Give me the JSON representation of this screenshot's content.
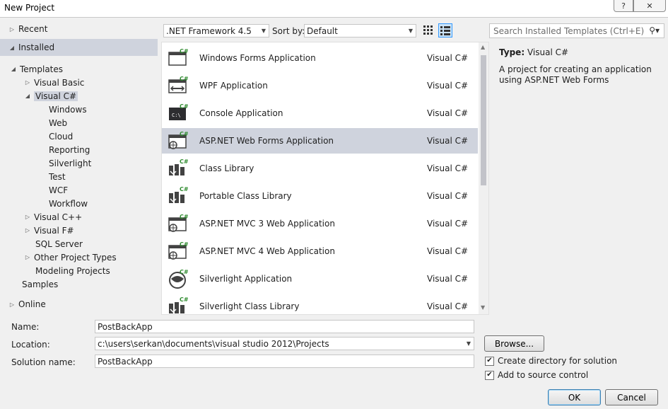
{
  "window": {
    "title": "New Project",
    "help_label": "?",
    "close_label": "✕"
  },
  "tree": {
    "recent": "Recent",
    "installed": "Installed",
    "templates": "Templates",
    "visual_basic": "Visual Basic",
    "visual_csharp": "Visual C#",
    "csharp_children": [
      "Windows",
      "Web",
      "Cloud",
      "Reporting",
      "Silverlight",
      "Test",
      "WCF",
      "Workflow"
    ],
    "visual_cpp": "Visual C++",
    "visual_fsharp": "Visual F#",
    "sql_server": "SQL Server",
    "other_project_types": "Other Project Types",
    "modeling_projects": "Modeling Projects",
    "samples": "Samples",
    "online": "Online"
  },
  "toolbar": {
    "framework": ".NET Framework 4.5",
    "sort_label": "Sort by:",
    "sort_value": "Default",
    "search_placeholder": "Search Installed Templates (Ctrl+E)"
  },
  "templates": [
    {
      "name": "Windows Forms Application",
      "lang": "Visual C#",
      "icon": "windows-forms-icon"
    },
    {
      "name": "WPF Application",
      "lang": "Visual C#",
      "icon": "wpf-icon"
    },
    {
      "name": "Console Application",
      "lang": "Visual C#",
      "icon": "console-icon"
    },
    {
      "name": "ASP.NET Web Forms Application",
      "lang": "Visual C#",
      "icon": "web-forms-icon"
    },
    {
      "name": "Class Library",
      "lang": "Visual C#",
      "icon": "class-library-icon"
    },
    {
      "name": "Portable Class Library",
      "lang": "Visual C#",
      "icon": "portable-class-library-icon"
    },
    {
      "name": "ASP.NET MVC 3 Web Application",
      "lang": "Visual C#",
      "icon": "mvc3-icon"
    },
    {
      "name": "ASP.NET MVC 4 Web Application",
      "lang": "Visual C#",
      "icon": "mvc4-icon"
    },
    {
      "name": "Silverlight Application",
      "lang": "Visual C#",
      "icon": "silverlight-icon"
    },
    {
      "name": "Silverlight Class Library",
      "lang": "Visual C#",
      "icon": "silverlight-class-library-icon"
    }
  ],
  "info": {
    "type_label": "Type:",
    "type_value": "Visual C#",
    "description": "A project for creating an application using ASP.NET Web Forms"
  },
  "form": {
    "name_label": "Name:",
    "name_value": "PostBackApp",
    "location_label": "Location:",
    "location_value": "c:\\users\\serkan\\documents\\visual studio 2012\\Projects",
    "solution_label": "Solution name:",
    "solution_value": "PostBackApp",
    "browse_label": "Browse...",
    "create_dir_label": "Create directory for solution",
    "source_control_label": "Add to source control",
    "ok_label": "OK",
    "cancel_label": "Cancel"
  },
  "colors": {
    "selection": "#cfd3dd",
    "dialog_bg": "#f0f0f0",
    "csharp_green": "#2e8b2e"
  }
}
